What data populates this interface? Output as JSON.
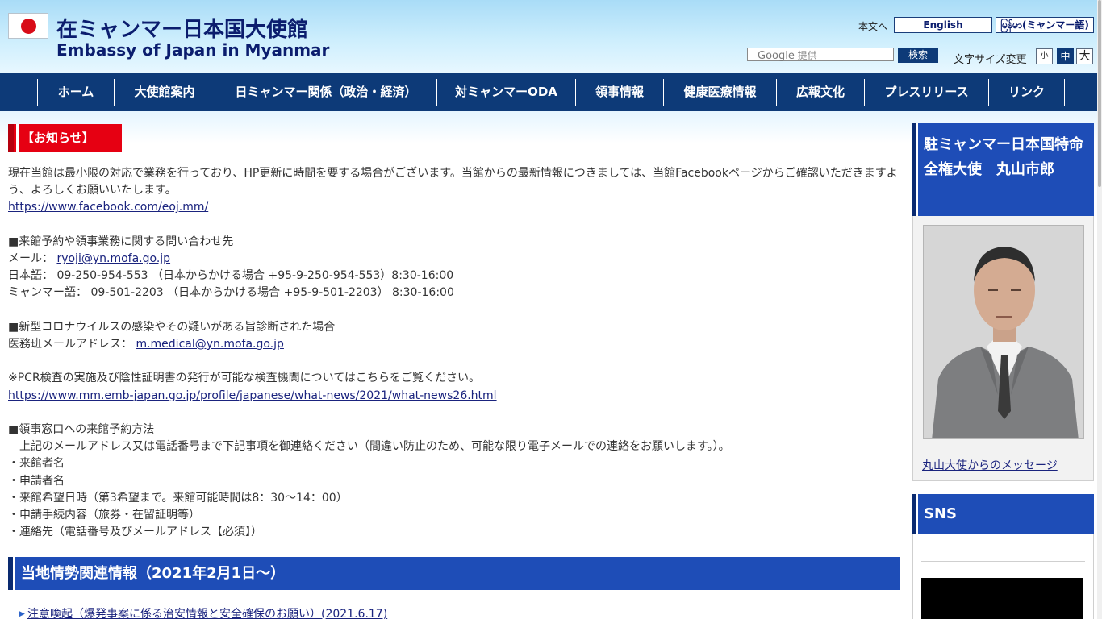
{
  "header": {
    "title_ja": "在ミャンマー日本国大使館",
    "title_en": "Embassy of Japan in Myanmar",
    "skip_link": "本文へ",
    "lang_en": "English",
    "lang_my": "မြန်မာ(ミャンマー語)",
    "search_placeholder_brand": "Google",
    "search_placeholder_suffix": "提供",
    "search_button": "検索",
    "font_size_label": "文字サイズ変更",
    "font_small": "小",
    "font_mid": "中",
    "font_large": "大"
  },
  "nav": {
    "items": [
      {
        "label": "ホーム"
      },
      {
        "label": "大使館案内"
      },
      {
        "label": "日ミャンマー関係（政治・経済）"
      },
      {
        "label": "対ミャンマーODA"
      },
      {
        "label": "領事情報"
      },
      {
        "label": "健康医療情報"
      },
      {
        "label": "広報文化"
      },
      {
        "label": "プレスリリース"
      },
      {
        "label": "リンク"
      }
    ]
  },
  "main": {
    "notice_label": "【お知らせ】",
    "intro_text": "現在当館は最小限の対応で業務を行っており、HP更新に時間を要する場合がございます。当館からの最新情報につきましては、当館Facebookページからご確認いただきますよう、よろしくお願いいたします。",
    "facebook_url": "https://www.facebook.com/eoj.mm/",
    "consular_heading": "■来館予約や領事業務に関する問い合わせ先",
    "mail_label": "メール：",
    "mail_address": "ryoji@yn.mofa.go.jp",
    "phone_ja": "日本語： 09-250-954-553 （日本からかける場合 +95-9-250-954-553）8:30-16:00",
    "phone_my": "ミャンマー語： 09-501-2203 （日本からかける場合 +95-9-501-2203） 8:30-16:00",
    "covid_heading": "■新型コロナウイルスの感染やその疑いがある旨診断された場合",
    "medical_label": "医務班メールアドレス：",
    "medical_address": "m.medical@yn.mofa.go.jp",
    "pcr_text": "※PCR検査の実施及び陰性証明書の発行が可能な検査機関についてはこちらをご覧ください。",
    "pcr_url": "https://www.mm.emb-japan.go.jp/profile/japanese/what-news/2021/what-news26.html",
    "reservation_heading": "■領事窓口への来館予約方法",
    "reservation_intro": "上記のメールアドレス又は電話番号まで下記事項を御連絡ください（間違い防止のため、可能な限り電子メールでの連絡をお願いします。）。",
    "reservation_items": [
      "・来館者名",
      "・申請者名",
      "・来館希望日時（第3希望まで。来館可能時間は8：30〜14：00）",
      "・申請手続内容（旅券・在留証明等）",
      "・連絡先（電話番号及びメールアドレス【必須】）"
    ],
    "section_title": "当地情勢関連情報（2021年2月1日〜）",
    "news_item": "注意喚起（爆発事案に係る治安情報と安全確保のお願い）(2021.6.17)"
  },
  "sidebar": {
    "ambassador_title": "駐ミャンマー日本国特命全権大使　丸山市郎",
    "ambassador_message_link": "丸山大使からのメッセージ",
    "sns_title": "SNS"
  }
}
